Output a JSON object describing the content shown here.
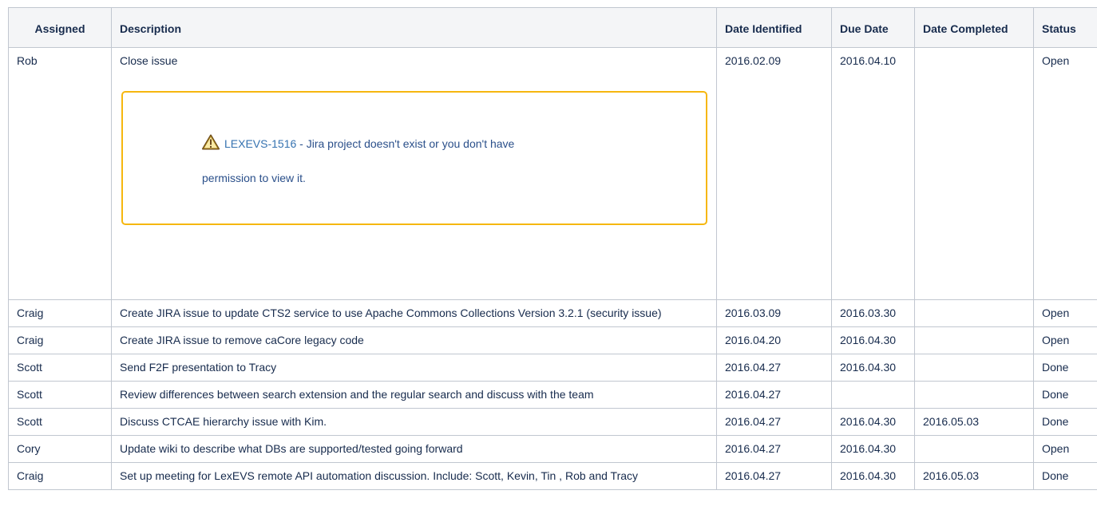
{
  "headers": {
    "assigned": "Assigned",
    "description": "Description",
    "date_identified": "Date Identified",
    "due_date": "Due Date",
    "date_completed": "Date Completed",
    "status": "Status"
  },
  "warning": {
    "icon": "warning-triangle-icon",
    "issue_key": "LEXEVS-1516",
    "message_part1": " - Jira project doesn't exist or you don't have",
    "message_part2": "permission to view it.",
    "border_color": "#f6b70f"
  },
  "rows": [
    {
      "assigned": "Rob",
      "description": "Close issue",
      "date_identified": "2016.02.09",
      "due_date": "2016.04.10",
      "date_completed": "",
      "status": "Open"
    },
    {
      "assigned": "Craig",
      "description": "Create JIRA issue to update CTS2 service to use Apache Commons Collections Version 3.2.1 (security issue)",
      "date_identified": "2016.03.09",
      "due_date": "2016.03.30",
      "date_completed": "",
      "status": "Open"
    },
    {
      "assigned": "Craig",
      "description": "Create JIRA issue to remove caCore legacy code",
      "date_identified": "2016.04.20",
      "due_date": "2016.04.30",
      "date_completed": "",
      "status": "Open"
    },
    {
      "assigned": "Scott",
      "description": "Send F2F presentation to Tracy",
      "date_identified": "2016.04.27",
      "due_date": "2016.04.30",
      "date_completed": "",
      "status": "Done"
    },
    {
      "assigned": "Scott",
      "description": "Review differences between search extension and the regular search and discuss with the team",
      "date_identified": "2016.04.27",
      "due_date": "",
      "date_completed": "",
      "status": "Done"
    },
    {
      "assigned": "Scott",
      "description": "Discuss CTCAE hierarchy issue with Kim.",
      "date_identified": "2016.04.27",
      "due_date": "2016.04.30",
      "date_completed": "2016.05.03",
      "status": "Done"
    },
    {
      "assigned": "Cory",
      "description": "Update wiki to describe what DBs are supported/tested going forward",
      "date_identified": "2016.04.27",
      "due_date": "2016.04.30",
      "date_completed": "",
      "status": "Open"
    },
    {
      "assigned": "Craig",
      "description": "Set up meeting for LexEVS remote API automation discussion.  Include: Scott, Kevin, Tin , Rob and Tracy",
      "date_identified": "2016.04.27",
      "due_date": "2016.04.30",
      "date_completed": "2016.05.03",
      "status": "Done"
    }
  ]
}
